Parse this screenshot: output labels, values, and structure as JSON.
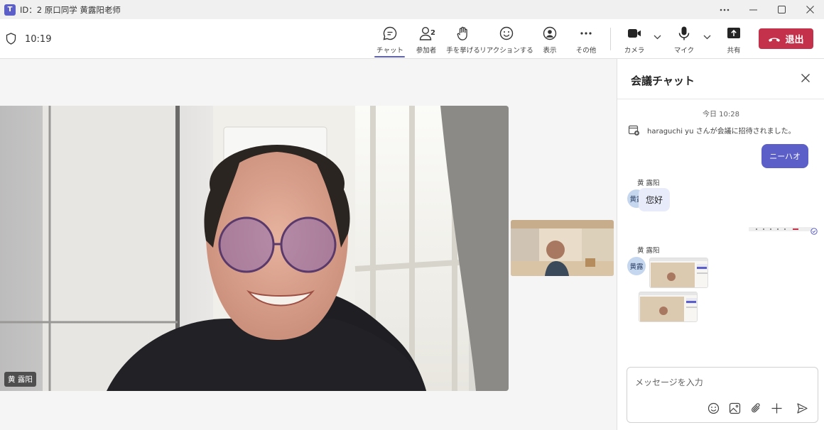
{
  "window": {
    "title": "ID：2 原口同学 黄露阳老师",
    "app_icon": "T"
  },
  "toolbar": {
    "timer": "10:19",
    "items": [
      {
        "label": "チャット",
        "icon": "chat-icon"
      },
      {
        "label": "参加者",
        "icon": "people-icon",
        "count": "2"
      },
      {
        "label": "手を挙げる",
        "icon": "raise-hand-icon"
      },
      {
        "label": "リアクションする",
        "icon": "emoji-icon"
      },
      {
        "label": "表示",
        "icon": "view-icon"
      },
      {
        "label": "その他",
        "icon": "more-icon"
      },
      {
        "label": "カメラ",
        "icon": "camera-icon"
      },
      {
        "label": "マイク",
        "icon": "mic-icon"
      },
      {
        "label": "共有",
        "icon": "share-icon"
      }
    ],
    "leave_label": "退出"
  },
  "stage": {
    "main_participant_name": "黄 露阳"
  },
  "chat": {
    "title": "会議チャット",
    "timestamp": "今日 10:28",
    "system_message": "haraguchi yu さんが会議に招待されました。",
    "my_message": "ニーハオ",
    "messages": [
      {
        "sender": "黄 露阳",
        "avatar": "黄露",
        "text": "您好"
      },
      {
        "sender": "黄 露阳",
        "avatar": "黄露"
      }
    ],
    "composer_placeholder": "メッセージを入力"
  },
  "colors": {
    "accent": "#5b5fc7",
    "leave": "#c4314b",
    "bubble_them": "#e8ebfa"
  }
}
